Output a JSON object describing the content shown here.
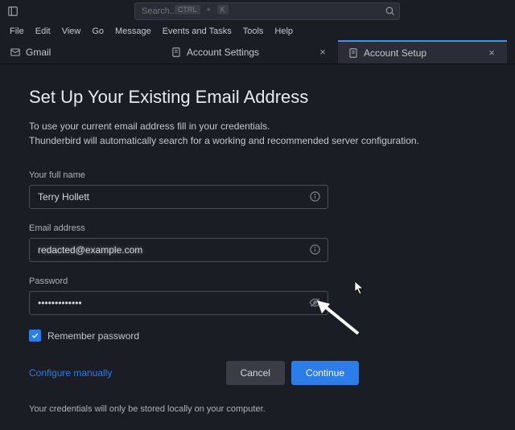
{
  "search": {
    "placeholder": "Search...",
    "kbd1": "CTRL",
    "kbdplus": "+",
    "kbd2": "K"
  },
  "menu": {
    "file": "File",
    "edit": "Edit",
    "view": "View",
    "go": "Go",
    "message": "Message",
    "events": "Events and Tasks",
    "tools": "Tools",
    "help": "Help"
  },
  "tabs": {
    "gmail": "Gmail",
    "settings": "Account Settings",
    "setup": "Account Setup",
    "close": "×"
  },
  "page": {
    "title": "Set Up Your Existing Email Address",
    "desc1": "To use your current email address fill in your credentials.",
    "desc2": "Thunderbird will automatically search for a working and recommended server configuration."
  },
  "form": {
    "name_label": "Your full name",
    "name_value": "Terry Hollett",
    "email_label": "Email address",
    "email_value": "redacted@example.com",
    "password_label": "Password",
    "password_value": "•••••••••••••",
    "remember_label": "Remember password"
  },
  "actions": {
    "config": "Configure manually",
    "cancel": "Cancel",
    "continue": "Continue"
  },
  "footer": "Your credentials will only be stored locally on your computer."
}
